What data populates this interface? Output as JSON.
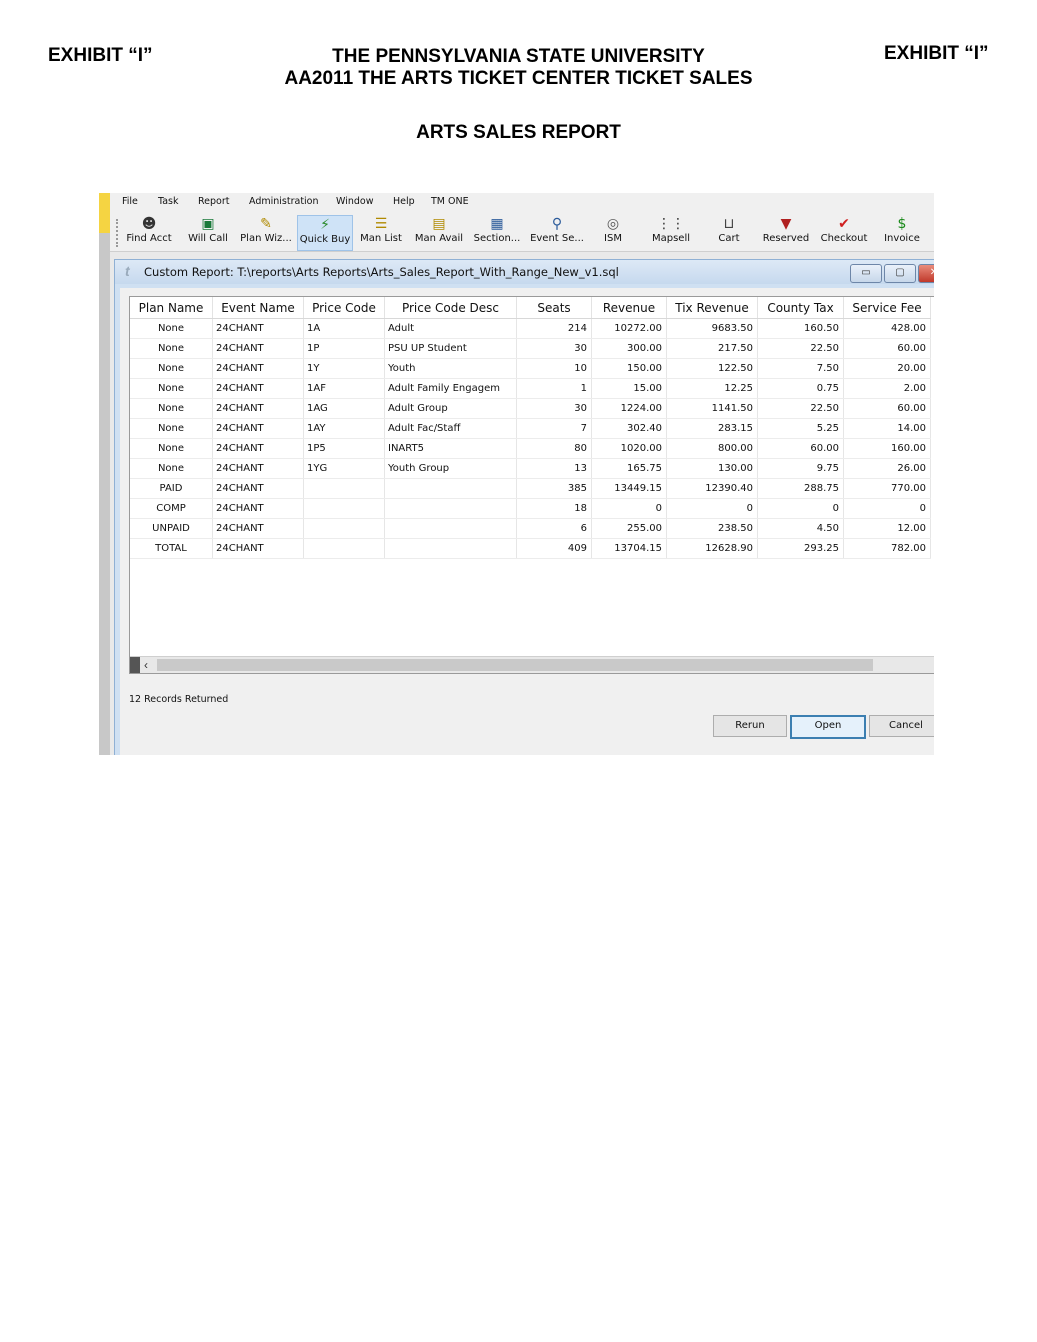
{
  "document": {
    "exhibit_left": "EXHIBIT “I”",
    "exhibit_right": "EXHIBIT “I”",
    "title_line1": "THE PENNSYLVANIA STATE UNIVERSITY",
    "title_line2": "AA2011 THE ARTS TICKET CENTER TICKET SALES",
    "report_title": "ARTS SALES REPORT"
  },
  "menu": [
    "File",
    "Task",
    "Report",
    "Administration",
    "Window",
    "Help",
    "TM ONE"
  ],
  "toolbar": [
    {
      "label": "Find Acct",
      "icon": "find-account-icon",
      "glyph": "🕵"
    },
    {
      "label": "Will Call",
      "icon": "will-call-icon",
      "glyph": "▦"
    },
    {
      "label": "Plan Wiz...",
      "icon": "plan-wizard-icon",
      "glyph": "✎"
    },
    {
      "label": "Quick Buy",
      "icon": "lightning-icon",
      "glyph": "⚡"
    },
    {
      "label": "Man List",
      "icon": "manifest-list-icon",
      "glyph": "📜"
    },
    {
      "label": "Man Avail",
      "icon": "manifest-avail-icon",
      "glyph": "📄"
    },
    {
      "label": "Section...",
      "icon": "section-grid-icon",
      "glyph": "▦"
    },
    {
      "label": "Event Se...",
      "icon": "event-search-icon",
      "glyph": "⚲"
    },
    {
      "label": "ISM",
      "icon": "ism-icon",
      "glyph": "◎"
    },
    {
      "label": "Mapsell",
      "icon": "mapsell-icon",
      "glyph": "⋮⋮"
    },
    {
      "label": "Cart",
      "icon": "cart-icon",
      "glyph": "🛒"
    },
    {
      "label": "Reserved",
      "icon": "reserved-icon",
      "glyph": "▼"
    },
    {
      "label": "Checkout",
      "icon": "checkmark-icon",
      "glyph": "✔"
    },
    {
      "label": "Invoice",
      "icon": "invoice-icon",
      "glyph": "$"
    }
  ],
  "window": {
    "title": "Custom Report:  T:\\reports\\Arts Reports\\Arts_Sales_Report_With_Range_New_v1.sql"
  },
  "table": {
    "columns": [
      "Plan Name",
      "Event Name",
      "Price Code",
      "Price Code Desc",
      "Seats",
      "Revenue",
      "Tix Revenue",
      "County Tax",
      "Service Fee"
    ],
    "rows": [
      [
        "None",
        "24CHANT",
        "1A",
        "Adult",
        "214",
        "10272.00",
        "9683.50",
        "160.50",
        "428.00"
      ],
      [
        "None",
        "24CHANT",
        "1P",
        "PSU UP Student",
        "30",
        "300.00",
        "217.50",
        "22.50",
        "60.00"
      ],
      [
        "None",
        "24CHANT",
        "1Y",
        "Youth",
        "10",
        "150.00",
        "122.50",
        "7.50",
        "20.00"
      ],
      [
        "None",
        "24CHANT",
        "1AF",
        "Adult Family Engagem",
        "1",
        "15.00",
        "12.25",
        "0.75",
        "2.00"
      ],
      [
        "None",
        "24CHANT",
        "1AG",
        "Adult Group",
        "30",
        "1224.00",
        "1141.50",
        "22.50",
        "60.00"
      ],
      [
        "None",
        "24CHANT",
        "1AY",
        "Adult Fac/Staff",
        "7",
        "302.40",
        "283.15",
        "5.25",
        "14.00"
      ],
      [
        "None",
        "24CHANT",
        "1P5",
        "INART5",
        "80",
        "1020.00",
        "800.00",
        "60.00",
        "160.00"
      ],
      [
        "None",
        "24CHANT",
        "1YG",
        "Youth Group",
        "13",
        "165.75",
        "130.00",
        "9.75",
        "26.00"
      ],
      [
        "PAID",
        "24CHANT",
        "",
        "",
        "385",
        "13449.15",
        "12390.40",
        "288.75",
        "770.00"
      ],
      [
        "COMP",
        "24CHANT",
        "",
        "",
        "18",
        "0",
        "0",
        "0",
        "0"
      ],
      [
        "UNPAID",
        "24CHANT",
        "",
        "",
        "6",
        "255.00",
        "238.50",
        "4.50",
        "12.00"
      ],
      [
        "TOTAL",
        "24CHANT",
        "",
        "",
        "409",
        "13704.15",
        "12628.90",
        "293.25",
        "782.00"
      ]
    ]
  },
  "status": "12 Records Returned",
  "buttons": {
    "rerun": "Rerun",
    "open": "Open",
    "cancel": "Cancel"
  }
}
